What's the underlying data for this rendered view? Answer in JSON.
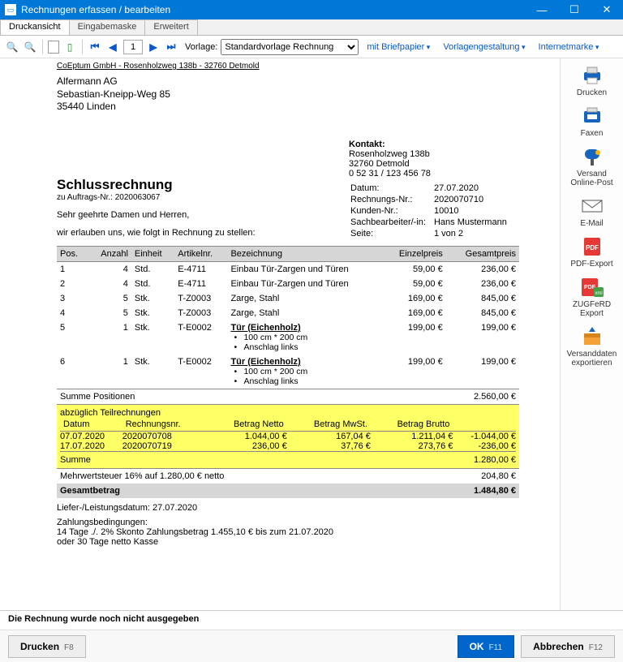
{
  "window": {
    "title": "Rechnungen erfassen / bearbeiten"
  },
  "tabs": {
    "t0": "Druckansicht",
    "t1": "Eingabemaske",
    "t2": "Erweitert"
  },
  "toolbar": {
    "page": "1",
    "vorlage_label": "Vorlage:",
    "vorlage_value": "Standardvorlage Rechnung",
    "briefpapier": "mit Briefpapier",
    "vorlagengestaltung": "Vorlagengestaltung",
    "internetmarke": "Internetmarke"
  },
  "rail": {
    "drucken": "Drucken",
    "faxen": "Faxen",
    "versand": "Versand\nOnline-Post",
    "email": "E-Mail",
    "pdf": "PDF-Export",
    "zugferd": "ZUGFeRD Export",
    "versanddaten": "Versanddaten\nexportieren"
  },
  "doc": {
    "sender_line": "CoEptum GmbH - Rosenholzweg 138b - 32760 Detmold",
    "recipient": {
      "name": "Alfermann AG",
      "street": "Sebastian-Kneipp-Weg 85",
      "city": "35440 Linden"
    },
    "contact_head": "Kontakt:",
    "contact": {
      "street": "Rosenholzweg 138b",
      "city": "32760 Detmold",
      "phone": "0 52 31 / 123 456 78"
    },
    "meta": {
      "datum_l": "Datum:",
      "datum_v": "27.07.2020",
      "rnr_l": "Rechnungs-Nr.:",
      "rnr_v": "2020070710",
      "knr_l": "Kunden-Nr.:",
      "knr_v": "10010",
      "sb_l": "Sachbearbeiter/-in:",
      "sb_v": "Hans Mustermann",
      "seite_l": "Seite:",
      "seite_v": "1 von 2"
    },
    "title": "Schlussrechnung",
    "sub": "zu Auftrags-Nr.: 2020063067",
    "salutation": "Sehr geehrte Damen und Herren,",
    "intro": "wir erlauben uns, wie folgt in Rechnung zu stellen:",
    "cols": {
      "pos": "Pos.",
      "anzahl": "Anzahl",
      "einheit": "Einheit",
      "artnr": "Artikelnr.",
      "bez": "Bezeichnung",
      "ep": "Einzelpreis",
      "gp": "Gesamtpreis"
    },
    "rows": [
      {
        "pos": "1",
        "anz": "4",
        "ein": "Std.",
        "art": "E-4711",
        "bez": "Einbau Tür-Zargen und Türen",
        "ep": "59,00 €",
        "gp": "236,00 €"
      },
      {
        "pos": "2",
        "anz": "4",
        "ein": "Std.",
        "art": "E-4711",
        "bez": "Einbau Tür-Zargen und Türen",
        "ep": "59,00 €",
        "gp": "236,00 €"
      },
      {
        "pos": "3",
        "anz": "5",
        "ein": "Stk.",
        "art": "T-Z0003",
        "bez": "Zarge, Stahl",
        "ep": "169,00 €",
        "gp": "845,00 €"
      },
      {
        "pos": "4",
        "anz": "5",
        "ein": "Stk.",
        "art": "T-Z0003",
        "bez": "Zarge, Stahl",
        "ep": "169,00 €",
        "gp": "845,00 €"
      },
      {
        "pos": "5",
        "anz": "1",
        "ein": "Stk.",
        "art": "T-E0002",
        "bez": "Tür (Eichenholz)",
        "sub1": "100 cm * 200 cm",
        "sub2": "Anschlag links",
        "ep": "199,00 €",
        "gp": "199,00 €",
        "link": true
      },
      {
        "pos": "6",
        "anz": "1",
        "ein": "Stk.",
        "art": "T-E0002",
        "bez": "Tür (Eichenholz)",
        "sub1": "100 cm * 200 cm",
        "sub2": "Anschlag links",
        "ep": "199,00 €",
        "gp": "199,00 €",
        "link": true
      }
    ],
    "sum_pos_l": "Summe Positionen",
    "sum_pos_v": "2.560,00 €",
    "partial": {
      "head": "abzüglich Teilrechnungen",
      "cols": {
        "d": "Datum",
        "r": "Rechnungsnr.",
        "n": "Betrag Netto",
        "m": "Betrag MwSt.",
        "b": "Betrag Brutto"
      },
      "rows": [
        {
          "d": "07.07.2020",
          "r": "2020070708",
          "n": "1.044,00 €",
          "m": "167,04 €",
          "b": "1.211,04 €",
          "off": "-1.044,00 €"
        },
        {
          "d": "17.07.2020",
          "r": "2020070719",
          "n": "236,00 €",
          "m": "37,76 €",
          "b": "273,76 €",
          "off": "-236,00 €"
        }
      ],
      "sum_l": "Summe",
      "sum_v": "1.280,00 €"
    },
    "vat_l": "Mehrwertsteuer 16% auf 1.280,00 € netto",
    "vat_v": "204,80 €",
    "total_l": "Gesamtbetrag",
    "total_v": "1.484,80 €",
    "liefer": "Liefer-/Leistungsdatum: 27.07.2020",
    "zb_head": "Zahlungsbedingungen:",
    "zb1": "14 Tage ./. 2% Skonto Zahlungsbetrag 1.455,10 € bis zum 21.07.2020",
    "zb2": "oder 30 Tage netto Kasse"
  },
  "status": "Die Rechnung wurde noch nicht ausgegeben",
  "buttons": {
    "drucken": "Drucken",
    "drucken_hk": "F8",
    "ok": "OK",
    "ok_hk": "F11",
    "abbrechen": "Abbrechen",
    "abbrechen_hk": "F12"
  }
}
